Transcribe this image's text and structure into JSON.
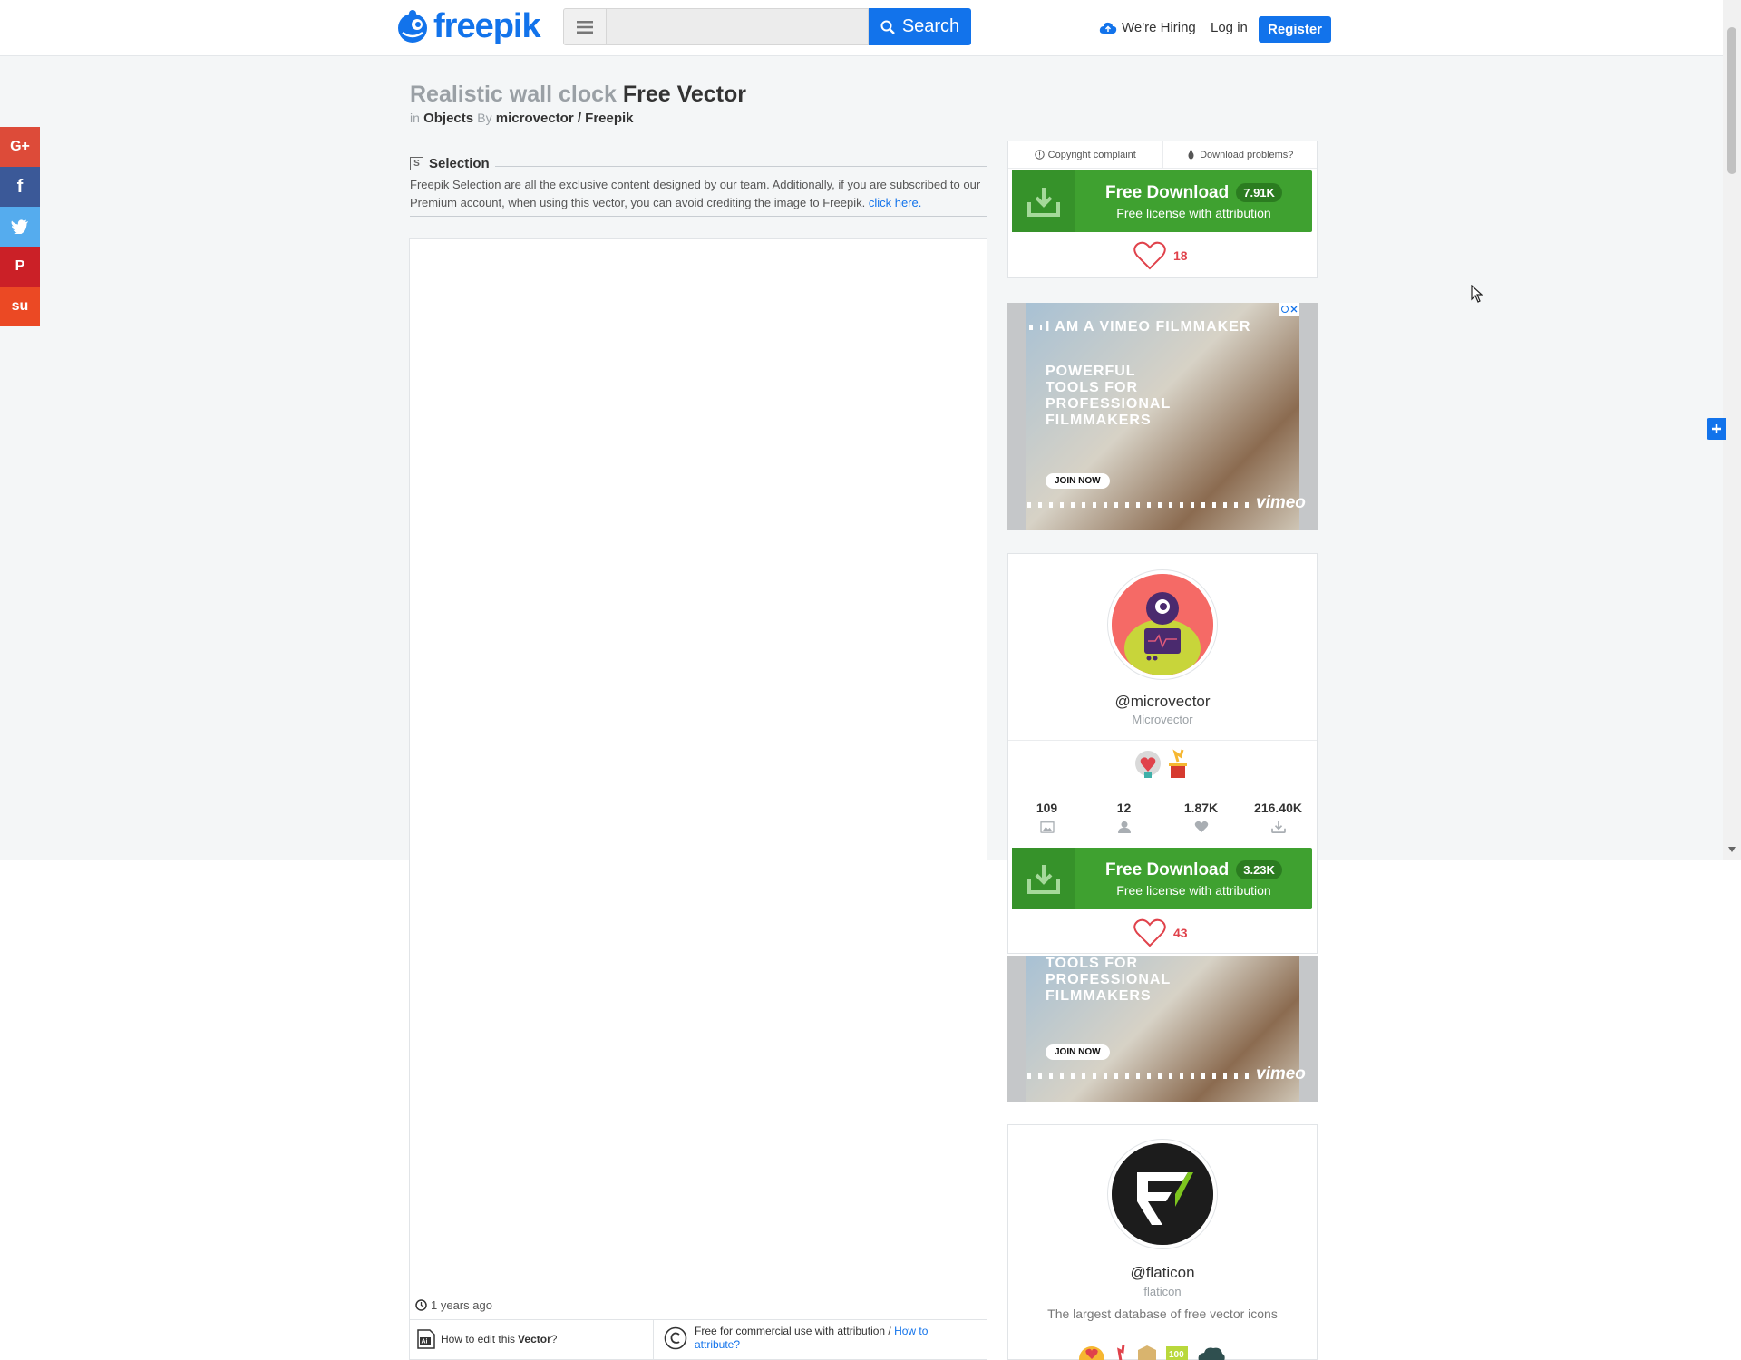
{
  "header": {
    "logo": "freepik",
    "search": {
      "placeholder": "",
      "button_label": "Search"
    },
    "hiring_label": "We're Hiring",
    "login_label": "Log in",
    "register_label": "Register"
  },
  "share": {
    "items": [
      {
        "label": "G+",
        "color": "#dd4b39"
      },
      {
        "label": "f",
        "color": "#3b5998"
      },
      {
        "label": "t",
        "color": "#55acee"
      },
      {
        "label": "P",
        "color": "#cb2027"
      },
      {
        "label": "su",
        "color": "#eb4924"
      }
    ]
  },
  "resource": {
    "title_gray": "Realistic wall clock",
    "title_dark": "Free Vector",
    "in_label": "in",
    "category": "Objects",
    "by_label": "By",
    "author": "microvector / Freepik",
    "selection_badge": "S",
    "selection_title": "Selection",
    "selection_text": "Freepik Selection are all the exclusive content designed by our team. Additionally, if you are subscribed to our Premium account, when using this vector, you can avoid crediting the image to Freepik.",
    "selection_link": "click here.",
    "posted": "1 years ago",
    "edit_prefix": "How to edit this",
    "edit_type": "Vector",
    "edit_suffix": "?",
    "license_text": "Free for commercial use with attribution /",
    "license_link": "How to attribute?"
  },
  "sidebar": {
    "copyright_label": "Copyright complaint",
    "problems_label": "Download problems?",
    "download": {
      "label": "Free Download",
      "count": "7.91K",
      "sub": "Free license with attribution",
      "likes": "18"
    },
    "download2": {
      "label": "Free Download",
      "count": "3.23K",
      "sub": "Free license with attribution",
      "likes": "43"
    },
    "ad": {
      "top": "I AM A VIMEO FILMMAKER",
      "headline": [
        "POWERFUL",
        "TOOLS FOR",
        "PROFESSIONAL",
        "FILMMAKERS"
      ],
      "headline2": [
        "TOOLS FOR",
        "PROFESSIONAL",
        "FILMMAKERS"
      ],
      "cta": "JOIN NOW",
      "brand": "vimeo"
    },
    "profile1": {
      "handle": "@microvector",
      "name": "Microvector",
      "stats": [
        {
          "value": "109",
          "icon": "images-icon"
        },
        {
          "value": "12",
          "icon": "followers-icon"
        },
        {
          "value": "1.87K",
          "icon": "heart-icon"
        },
        {
          "value": "216.40K",
          "icon": "download-icon"
        }
      ]
    },
    "profile2": {
      "handle": "@flaticon",
      "name": "flaticon",
      "description": "The largest database of free vector icons"
    }
  },
  "colors": {
    "brand": "#1273eb",
    "download_green": "#3fa130",
    "like_red": "#e0424b"
  }
}
